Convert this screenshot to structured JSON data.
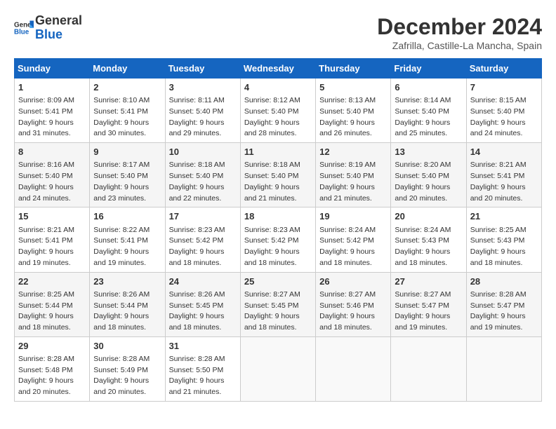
{
  "logo": {
    "line1": "General",
    "line2": "Blue"
  },
  "title": "December 2024",
  "subtitle": "Zafrilla, Castille-La Mancha, Spain",
  "days_header": [
    "Sunday",
    "Monday",
    "Tuesday",
    "Wednesday",
    "Thursday",
    "Friday",
    "Saturday"
  ],
  "weeks": [
    [
      {
        "day": "1",
        "info": "Sunrise: 8:09 AM\nSunset: 5:41 PM\nDaylight: 9 hours\nand 31 minutes."
      },
      {
        "day": "2",
        "info": "Sunrise: 8:10 AM\nSunset: 5:41 PM\nDaylight: 9 hours\nand 30 minutes."
      },
      {
        "day": "3",
        "info": "Sunrise: 8:11 AM\nSunset: 5:40 PM\nDaylight: 9 hours\nand 29 minutes."
      },
      {
        "day": "4",
        "info": "Sunrise: 8:12 AM\nSunset: 5:40 PM\nDaylight: 9 hours\nand 28 minutes."
      },
      {
        "day": "5",
        "info": "Sunrise: 8:13 AM\nSunset: 5:40 PM\nDaylight: 9 hours\nand 26 minutes."
      },
      {
        "day": "6",
        "info": "Sunrise: 8:14 AM\nSunset: 5:40 PM\nDaylight: 9 hours\nand 25 minutes."
      },
      {
        "day": "7",
        "info": "Sunrise: 8:15 AM\nSunset: 5:40 PM\nDaylight: 9 hours\nand 24 minutes."
      }
    ],
    [
      {
        "day": "8",
        "info": "Sunrise: 8:16 AM\nSunset: 5:40 PM\nDaylight: 9 hours\nand 24 minutes."
      },
      {
        "day": "9",
        "info": "Sunrise: 8:17 AM\nSunset: 5:40 PM\nDaylight: 9 hours\nand 23 minutes."
      },
      {
        "day": "10",
        "info": "Sunrise: 8:18 AM\nSunset: 5:40 PM\nDaylight: 9 hours\nand 22 minutes."
      },
      {
        "day": "11",
        "info": "Sunrise: 8:18 AM\nSunset: 5:40 PM\nDaylight: 9 hours\nand 21 minutes."
      },
      {
        "day": "12",
        "info": "Sunrise: 8:19 AM\nSunset: 5:40 PM\nDaylight: 9 hours\nand 21 minutes."
      },
      {
        "day": "13",
        "info": "Sunrise: 8:20 AM\nSunset: 5:40 PM\nDaylight: 9 hours\nand 20 minutes."
      },
      {
        "day": "14",
        "info": "Sunrise: 8:21 AM\nSunset: 5:41 PM\nDaylight: 9 hours\nand 20 minutes."
      }
    ],
    [
      {
        "day": "15",
        "info": "Sunrise: 8:21 AM\nSunset: 5:41 PM\nDaylight: 9 hours\nand 19 minutes."
      },
      {
        "day": "16",
        "info": "Sunrise: 8:22 AM\nSunset: 5:41 PM\nDaylight: 9 hours\nand 19 minutes."
      },
      {
        "day": "17",
        "info": "Sunrise: 8:23 AM\nSunset: 5:42 PM\nDaylight: 9 hours\nand 18 minutes."
      },
      {
        "day": "18",
        "info": "Sunrise: 8:23 AM\nSunset: 5:42 PM\nDaylight: 9 hours\nand 18 minutes."
      },
      {
        "day": "19",
        "info": "Sunrise: 8:24 AM\nSunset: 5:42 PM\nDaylight: 9 hours\nand 18 minutes."
      },
      {
        "day": "20",
        "info": "Sunrise: 8:24 AM\nSunset: 5:43 PM\nDaylight: 9 hours\nand 18 minutes."
      },
      {
        "day": "21",
        "info": "Sunrise: 8:25 AM\nSunset: 5:43 PM\nDaylight: 9 hours\nand 18 minutes."
      }
    ],
    [
      {
        "day": "22",
        "info": "Sunrise: 8:25 AM\nSunset: 5:44 PM\nDaylight: 9 hours\nand 18 minutes."
      },
      {
        "day": "23",
        "info": "Sunrise: 8:26 AM\nSunset: 5:44 PM\nDaylight: 9 hours\nand 18 minutes."
      },
      {
        "day": "24",
        "info": "Sunrise: 8:26 AM\nSunset: 5:45 PM\nDaylight: 9 hours\nand 18 minutes."
      },
      {
        "day": "25",
        "info": "Sunrise: 8:27 AM\nSunset: 5:45 PM\nDaylight: 9 hours\nand 18 minutes."
      },
      {
        "day": "26",
        "info": "Sunrise: 8:27 AM\nSunset: 5:46 PM\nDaylight: 9 hours\nand 18 minutes."
      },
      {
        "day": "27",
        "info": "Sunrise: 8:27 AM\nSunset: 5:47 PM\nDaylight: 9 hours\nand 19 minutes."
      },
      {
        "day": "28",
        "info": "Sunrise: 8:28 AM\nSunset: 5:47 PM\nDaylight: 9 hours\nand 19 minutes."
      }
    ],
    [
      {
        "day": "29",
        "info": "Sunrise: 8:28 AM\nSunset: 5:48 PM\nDaylight: 9 hours\nand 20 minutes."
      },
      {
        "day": "30",
        "info": "Sunrise: 8:28 AM\nSunset: 5:49 PM\nDaylight: 9 hours\nand 20 minutes."
      },
      {
        "day": "31",
        "info": "Sunrise: 8:28 AM\nSunset: 5:50 PM\nDaylight: 9 hours\nand 21 minutes."
      },
      null,
      null,
      null,
      null
    ]
  ]
}
